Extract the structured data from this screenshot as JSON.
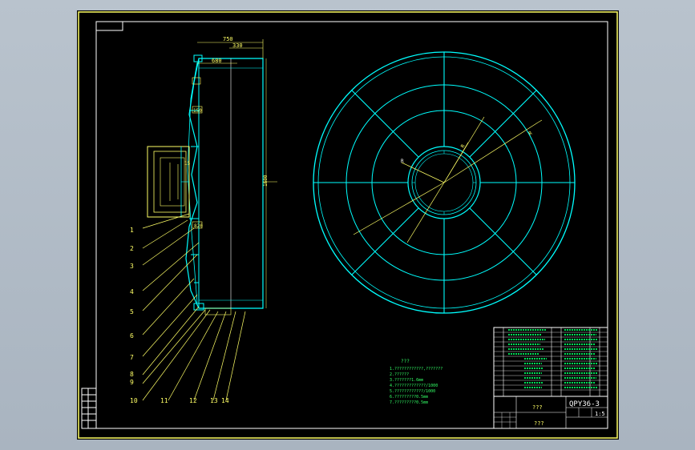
{
  "colors": {
    "background": "#000000",
    "outline": "#ffff66",
    "geometry": "#00ffff",
    "text": "#ffff66",
    "table_text": "#33ff66"
  },
  "dimensions": {
    "d750": "750",
    "d330": "330",
    "d680": "680",
    "d150": "150",
    "d15": "15",
    "d1600": "1600",
    "d820": "820"
  },
  "leaders": [
    "1",
    "2",
    "3",
    "4",
    "5",
    "6",
    "7",
    "8",
    "9",
    "10",
    "11",
    "12",
    "13",
    "14"
  ],
  "plan_labels": {
    "r1": "R",
    "r2": "R",
    "r3": "R"
  },
  "notes": {
    "title": "???",
    "lines": [
      "1.????????????,???????",
      "2.??????",
      "3.???????1.6mm",
      "4.?????????????/1000",
      "5.????????????/1000",
      "6.?????????0.5mm",
      "7.?????????0.5mm"
    ]
  },
  "title_block": {
    "drawing_no": "QPY36-3",
    "name": "???",
    "scale": "1:5",
    "name2": "???"
  }
}
